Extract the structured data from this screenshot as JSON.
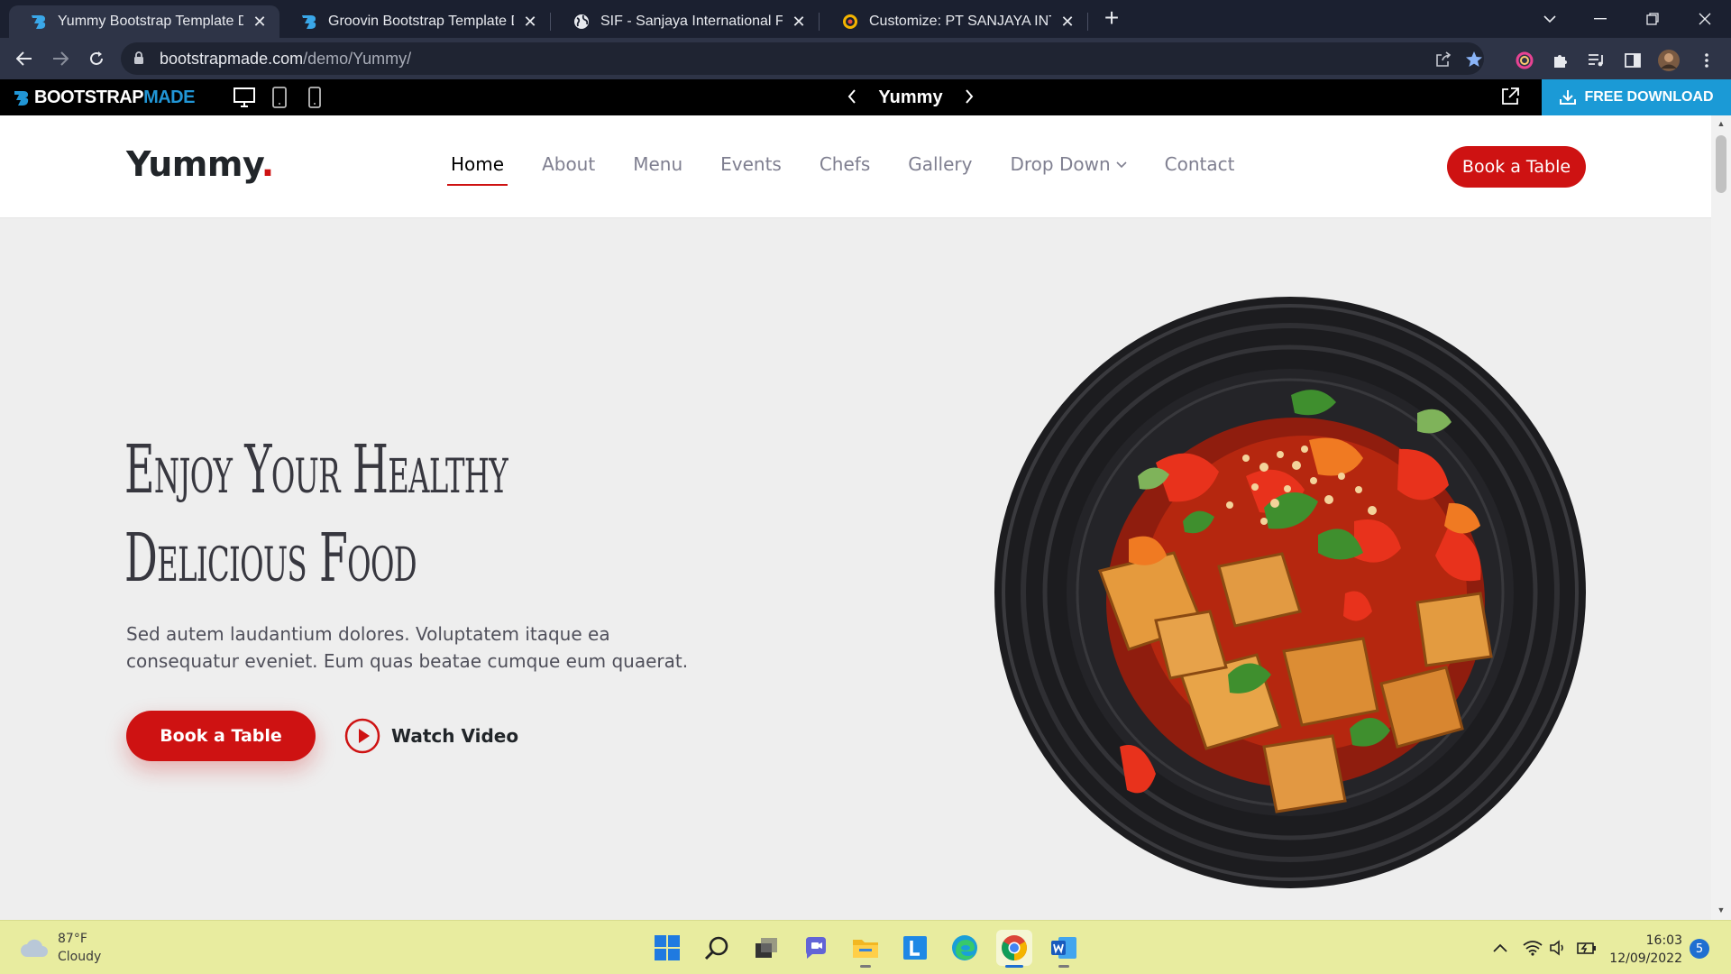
{
  "browser": {
    "tabs": [
      {
        "title": "Yummy Bootstrap Template Dem",
        "favicon": "bootstrapmade-icon",
        "active": true
      },
      {
        "title": "Groovin Bootstrap Template Dem",
        "favicon": "bootstrapmade-icon",
        "active": false
      },
      {
        "title": "SIF - Sanjaya International Fisher",
        "favicon": "globe-icon",
        "active": false
      },
      {
        "title": "Customize: PT SANJAYA INTERNA",
        "favicon": "wordpress-icon",
        "active": false
      }
    ],
    "url_host": "bootstrapmade.com",
    "url_path": "/demo/Yummy/"
  },
  "demobar": {
    "brand_primary": "BOOTSTRAP",
    "brand_secondary": "MADE",
    "template_name": "Yummy",
    "download_label": "FREE DOWNLOAD"
  },
  "site": {
    "logo": "Yummy",
    "logo_dot": ".",
    "nav": [
      {
        "label": "Home",
        "active": true
      },
      {
        "label": "About"
      },
      {
        "label": "Menu"
      },
      {
        "label": "Events"
      },
      {
        "label": "Chefs"
      },
      {
        "label": "Gallery"
      },
      {
        "label": "Drop Down",
        "dropdown": true
      },
      {
        "label": "Contact"
      }
    ],
    "header_cta": "Book a Table"
  },
  "hero": {
    "title_line1": "Enjoy Your Healthy",
    "title_line2": "Delicious Food",
    "text": "Sed autem laudantium dolores. Voluptatem itaque ea consequatur eveniet. Eum quas beatae cumque eum quaerat.",
    "book_label": "Book a Table",
    "watch_label": "Watch Video"
  },
  "taskbar": {
    "weather_temp": "87°F",
    "weather_desc": "Cloudy",
    "time": "16:03",
    "date": "12/09/2022",
    "notifications": "5",
    "apps": [
      "windows-start-icon",
      "search-icon",
      "task-view-icon",
      "teams-chat-icon",
      "file-explorer-icon",
      "l-app-icon",
      "edge-icon",
      "chrome-icon",
      "word-icon"
    ]
  },
  "colors": {
    "accent": "#ce1212",
    "download_bg": "#1b9ad6",
    "browser_frame": "#1b2030",
    "taskbar_bg": "#e8ec9f"
  }
}
